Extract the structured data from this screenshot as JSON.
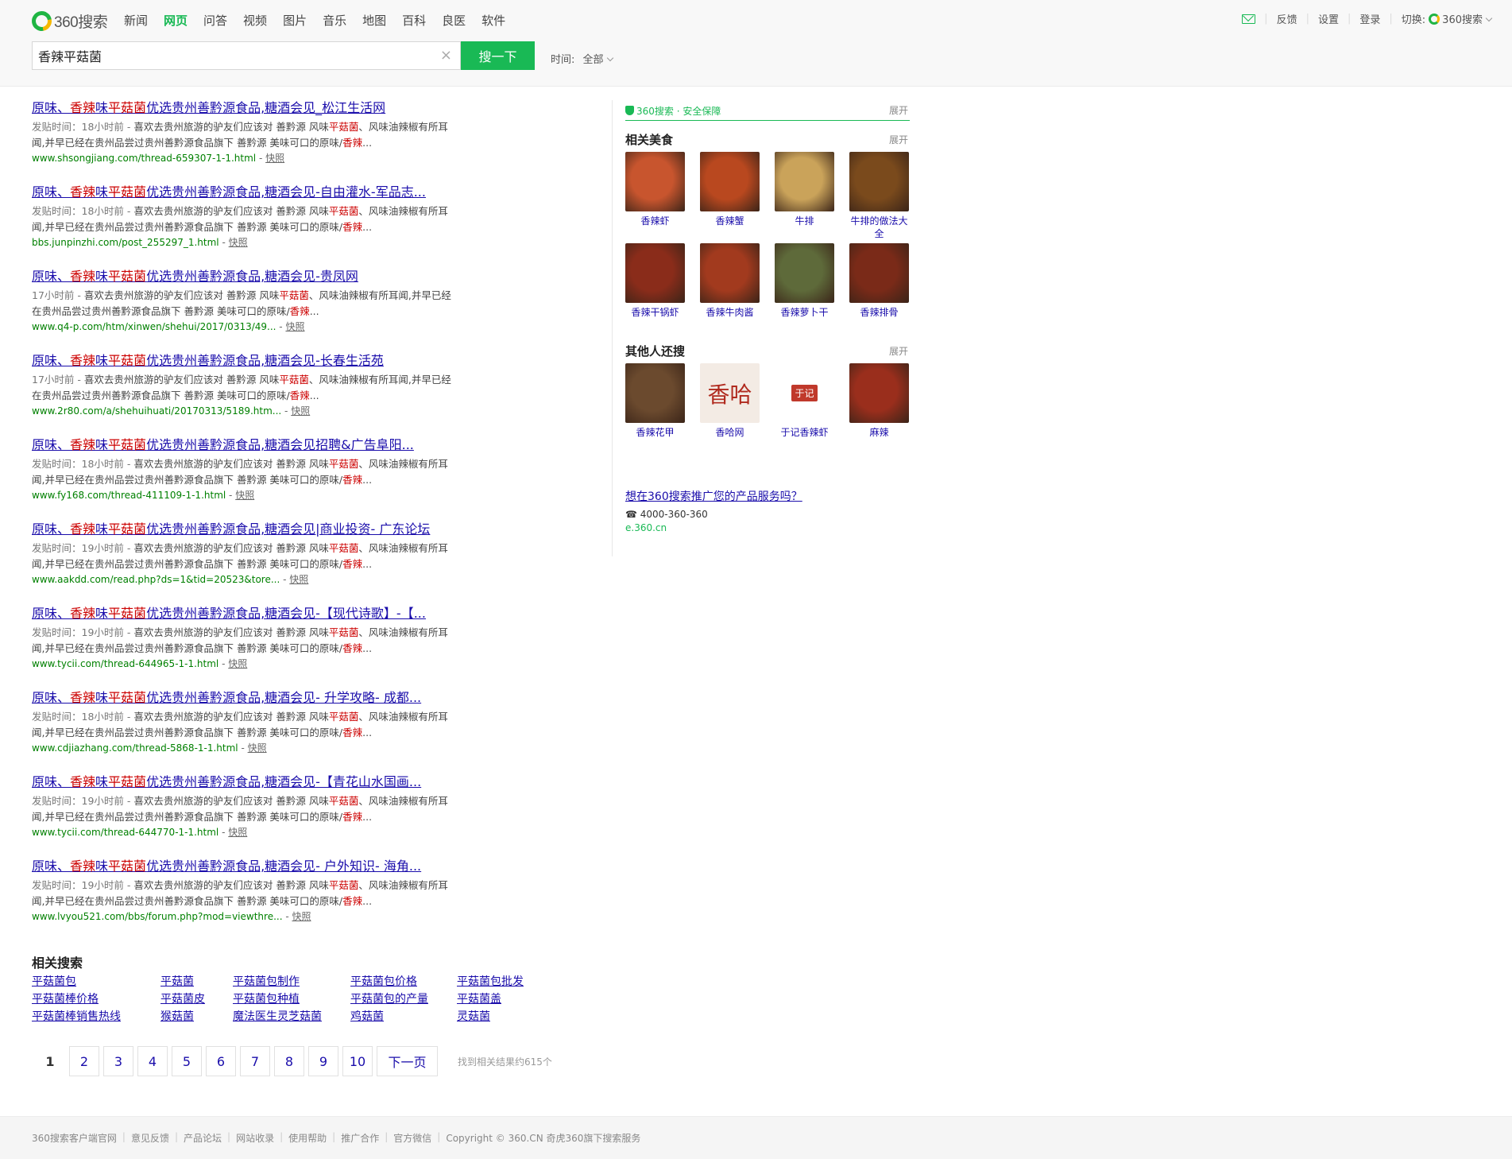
{
  "header": {
    "logo_text": "360搜索",
    "nav": [
      "新闻",
      "网页",
      "问答",
      "视频",
      "图片",
      "音乐",
      "地图",
      "百科",
      "良医",
      "软件"
    ],
    "active_nav": "网页",
    "top_links": [
      "反馈",
      "设置",
      "登录"
    ],
    "switch_label": "切换:",
    "switch_value": "360搜索"
  },
  "search": {
    "query": "香辣平菇菌",
    "button": "搜一下",
    "clear": "×",
    "time_label": "时间:",
    "time_value": "全部"
  },
  "results": [
    {
      "title_pre": "原味、",
      "title_hl1": "香辣",
      "title_mid": "味",
      "title_hl2": "平菇菌",
      "title_post": "优选贵州善黔源食品,糖酒会见_松江生活网",
      "desc_meta": "发贴时间：18小时前 - ",
      "desc_a": "喜欢去贵州旅游的驴友们应该对 善黔源 风味",
      "desc_hl1": "平菇菌",
      "desc_b": "、风味油辣椒有所耳闻,并早已经在贵州品尝过贵州善黔源食品旗下 善黔源 美味可口的原味/",
      "desc_hl2": "香辣",
      "desc_c": "...",
      "url": "www.shsongjiang.com/thread-659307-1-1.html",
      "snap": "快照"
    },
    {
      "title_pre": "原味、",
      "title_hl1": "香辣",
      "title_mid": "味",
      "title_hl2": "平菇菌",
      "title_post": "优选贵州善黔源食品,糖酒会见-自由灌水-军品志...",
      "desc_meta": "发贴时间：18小时前 - ",
      "desc_a": "喜欢去贵州旅游的驴友们应该对 善黔源 风味",
      "desc_hl1": "平菇菌",
      "desc_b": "、风味油辣椒有所耳闻,并早已经在贵州品尝过贵州善黔源食品旗下 善黔源 美味可口的原味/",
      "desc_hl2": "香辣",
      "desc_c": "...",
      "url": "bbs.junpinzhi.com/post_255297_1.html",
      "snap": "快照"
    },
    {
      "title_pre": "原味、",
      "title_hl1": "香辣",
      "title_mid": "味",
      "title_hl2": "平菇菌",
      "title_post": "优选贵州善黔源食品,糖酒会见-贵凤网",
      "desc_meta": "17小时前 - ",
      "desc_a": "喜欢去贵州旅游的驴友们应该对 善黔源 风味",
      "desc_hl1": "平菇菌",
      "desc_b": "、风味油辣椒有所耳闻,并早已经在贵州品尝过贵州善黔源食品旗下 善黔源 美味可口的原味/",
      "desc_hl2": "香辣",
      "desc_c": "...",
      "url": "www.q4-p.com/htm/xinwen/shehui/2017/0313/49...",
      "snap": "快照"
    },
    {
      "title_pre": "原味、",
      "title_hl1": "香辣",
      "title_mid": "味",
      "title_hl2": "平菇菌",
      "title_post": "优选贵州善黔源食品,糖酒会见-长春生活苑",
      "desc_meta": "17小时前 - ",
      "desc_a": "喜欢去贵州旅游的驴友们应该对 善黔源 风味",
      "desc_hl1": "平菇菌",
      "desc_b": "、风味油辣椒有所耳闻,并早已经在贵州品尝过贵州善黔源食品旗下 善黔源 美味可口的原味/",
      "desc_hl2": "香辣",
      "desc_c": "...",
      "url": "www.2r80.com/a/shehuihuati/20170313/5189.htm...",
      "snap": "快照"
    },
    {
      "title_pre": "原味、",
      "title_hl1": "香辣",
      "title_mid": "味",
      "title_hl2": "平菇菌",
      "title_post": "优选贵州善黔源食品,糖酒会见招聘&广告阜阳...",
      "desc_meta": "发贴时间：18小时前 - ",
      "desc_a": "喜欢去贵州旅游的驴友们应该对 善黔源 风味",
      "desc_hl1": "平菇菌",
      "desc_b": "、风味油辣椒有所耳闻,并早已经在贵州品尝过贵州善黔源食品旗下 善黔源 美味可口的原味/",
      "desc_hl2": "香辣",
      "desc_c": "...",
      "url": "www.fy168.com/thread-411109-1-1.html",
      "snap": "快照"
    },
    {
      "title_pre": "原味、",
      "title_hl1": "香辣",
      "title_mid": "味",
      "title_hl2": "平菇菌",
      "title_post": "优选贵州善黔源食品,糖酒会见|商业投资- 广东论坛",
      "desc_meta": "发贴时间：19小时前 - ",
      "desc_a": "喜欢去贵州旅游的驴友们应该对 善黔源 风味",
      "desc_hl1": "平菇菌",
      "desc_b": "、风味油辣椒有所耳闻,并早已经在贵州品尝过贵州善黔源食品旗下 善黔源 美味可口的原味/",
      "desc_hl2": "香辣",
      "desc_c": "...",
      "url": "www.aakdd.com/read.php?ds=1&tid=20523&tore...",
      "snap": "快照"
    },
    {
      "title_pre": "原味、",
      "title_hl1": "香辣",
      "title_mid": "味",
      "title_hl2": "平菇菌",
      "title_post": "优选贵州善黔源食品,糖酒会见-【现代诗歌】-【...",
      "desc_meta": "发贴时间：19小时前 - ",
      "desc_a": "喜欢去贵州旅游的驴友们应该对 善黔源 风味",
      "desc_hl1": "平菇菌",
      "desc_b": "、风味油辣椒有所耳闻,并早已经在贵州品尝过贵州善黔源食品旗下 善黔源 美味可口的原味/",
      "desc_hl2": "香辣",
      "desc_c": "...",
      "url": "www.tycii.com/thread-644965-1-1.html",
      "snap": "快照"
    },
    {
      "title_pre": "原味、",
      "title_hl1": "香辣",
      "title_mid": "味",
      "title_hl2": "平菇菌",
      "title_post": "优选贵州善黔源食品,糖酒会见- 升学攻略- 成都...",
      "desc_meta": "发贴时间：18小时前 - ",
      "desc_a": "喜欢去贵州旅游的驴友们应该对 善黔源 风味",
      "desc_hl1": "平菇菌",
      "desc_b": "、风味油辣椒有所耳闻,并早已经在贵州品尝过贵州善黔源食品旗下 善黔源 美味可口的原味/",
      "desc_hl2": "香辣",
      "desc_c": "...",
      "url": "www.cdjiazhang.com/thread-5868-1-1.html",
      "snap": "快照"
    },
    {
      "title_pre": "原味、",
      "title_hl1": "香辣",
      "title_mid": "味",
      "title_hl2": "平菇菌",
      "title_post": "优选贵州善黔源食品,糖酒会见-【青花山水国画...",
      "desc_meta": "发贴时间：19小时前 - ",
      "desc_a": "喜欢去贵州旅游的驴友们应该对 善黔源 风味",
      "desc_hl1": "平菇菌",
      "desc_b": "、风味油辣椒有所耳闻,并早已经在贵州品尝过贵州善黔源食品旗下 善黔源 美味可口的原味/",
      "desc_hl2": "香辣",
      "desc_c": "...",
      "url": "www.tycii.com/thread-644770-1-1.html",
      "snap": "快照"
    },
    {
      "title_pre": "原味、",
      "title_hl1": "香辣",
      "title_mid": "味",
      "title_hl2": "平菇菌",
      "title_post": "优选贵州善黔源食品,糖酒会见- 户外知识- 海角...",
      "desc_meta": "发贴时间：19小时前 - ",
      "desc_a": "喜欢去贵州旅游的驴友们应该对 善黔源 风味",
      "desc_hl1": "平菇菌",
      "desc_b": "、风味油辣椒有所耳闻,并早已经在贵州品尝过贵州善黔源食品旗下 善黔源 美味可口的原味/",
      "desc_hl2": "香辣",
      "desc_c": "...",
      "url": "www.lvyou521.com/bbs/forum.php?mod=viewthre...",
      "snap": "快照"
    }
  ],
  "related_searches": {
    "title": "相关搜索",
    "items": [
      "平菇菌包",
      "平菇菌",
      "平菇菌包制作",
      "平菇菌包价格",
      "平菇菌包批发",
      "平菇菌棒价格",
      "平菇菌皮",
      "平菇菌包种植",
      "平菇菌包的产量",
      "平菇菌盖",
      "平菇菌棒销售热线",
      "猴菇菌",
      "魔法医生灵芝菇菌",
      "鸡菇菌",
      "灵菇菌"
    ]
  },
  "pagination": {
    "pages": [
      "1",
      "2",
      "3",
      "4",
      "5",
      "6",
      "7",
      "8",
      "9",
      "10"
    ],
    "current": "1",
    "next": "下一页",
    "count_text": "找到相关结果约615个"
  },
  "sidebar": {
    "safe_text": "360搜索 · 安全保障",
    "expand_label": "展开",
    "food_title": "相关美食",
    "food": [
      {
        "label": "香辣虾",
        "color": "#c8552e"
      },
      {
        "label": "香辣蟹",
        "color": "#b9481f"
      },
      {
        "label": "牛排",
        "color": "#caa35a"
      },
      {
        "label": "牛排的做法大全",
        "color": "#7a4a1c"
      },
      {
        "label": "香辣干锅虾",
        "color": "#8a2c1a"
      },
      {
        "label": "香辣牛肉酱",
        "color": "#a23a1e"
      },
      {
        "label": "香辣萝卜干",
        "color": "#5e6a3a"
      },
      {
        "label": "香辣排骨",
        "color": "#7a2a18"
      }
    ],
    "others_title": "其他人还搜",
    "others": [
      {
        "label": "香辣花甲",
        "color": "#6b4a2e"
      },
      {
        "label": "香哈网",
        "brand": "香哈"
      },
      {
        "label": "于记香辣虾",
        "brand": "于记"
      },
      {
        "label": "麻辣",
        "color": "#9a2e1c"
      }
    ],
    "ad_link": "想在360搜索推广您的产品服务吗？",
    "ad_phone": "☎ 4000-360-360",
    "ad_domain": "e.360.cn"
  },
  "footer": {
    "links": [
      "360搜索客户端官网",
      "意见反馈",
      "产品论坛",
      "网站收录",
      "使用帮助",
      "推广合作",
      "官方微信"
    ],
    "copyright": "Copyright © 360.CN 奇虎360旗下搜索服务"
  }
}
